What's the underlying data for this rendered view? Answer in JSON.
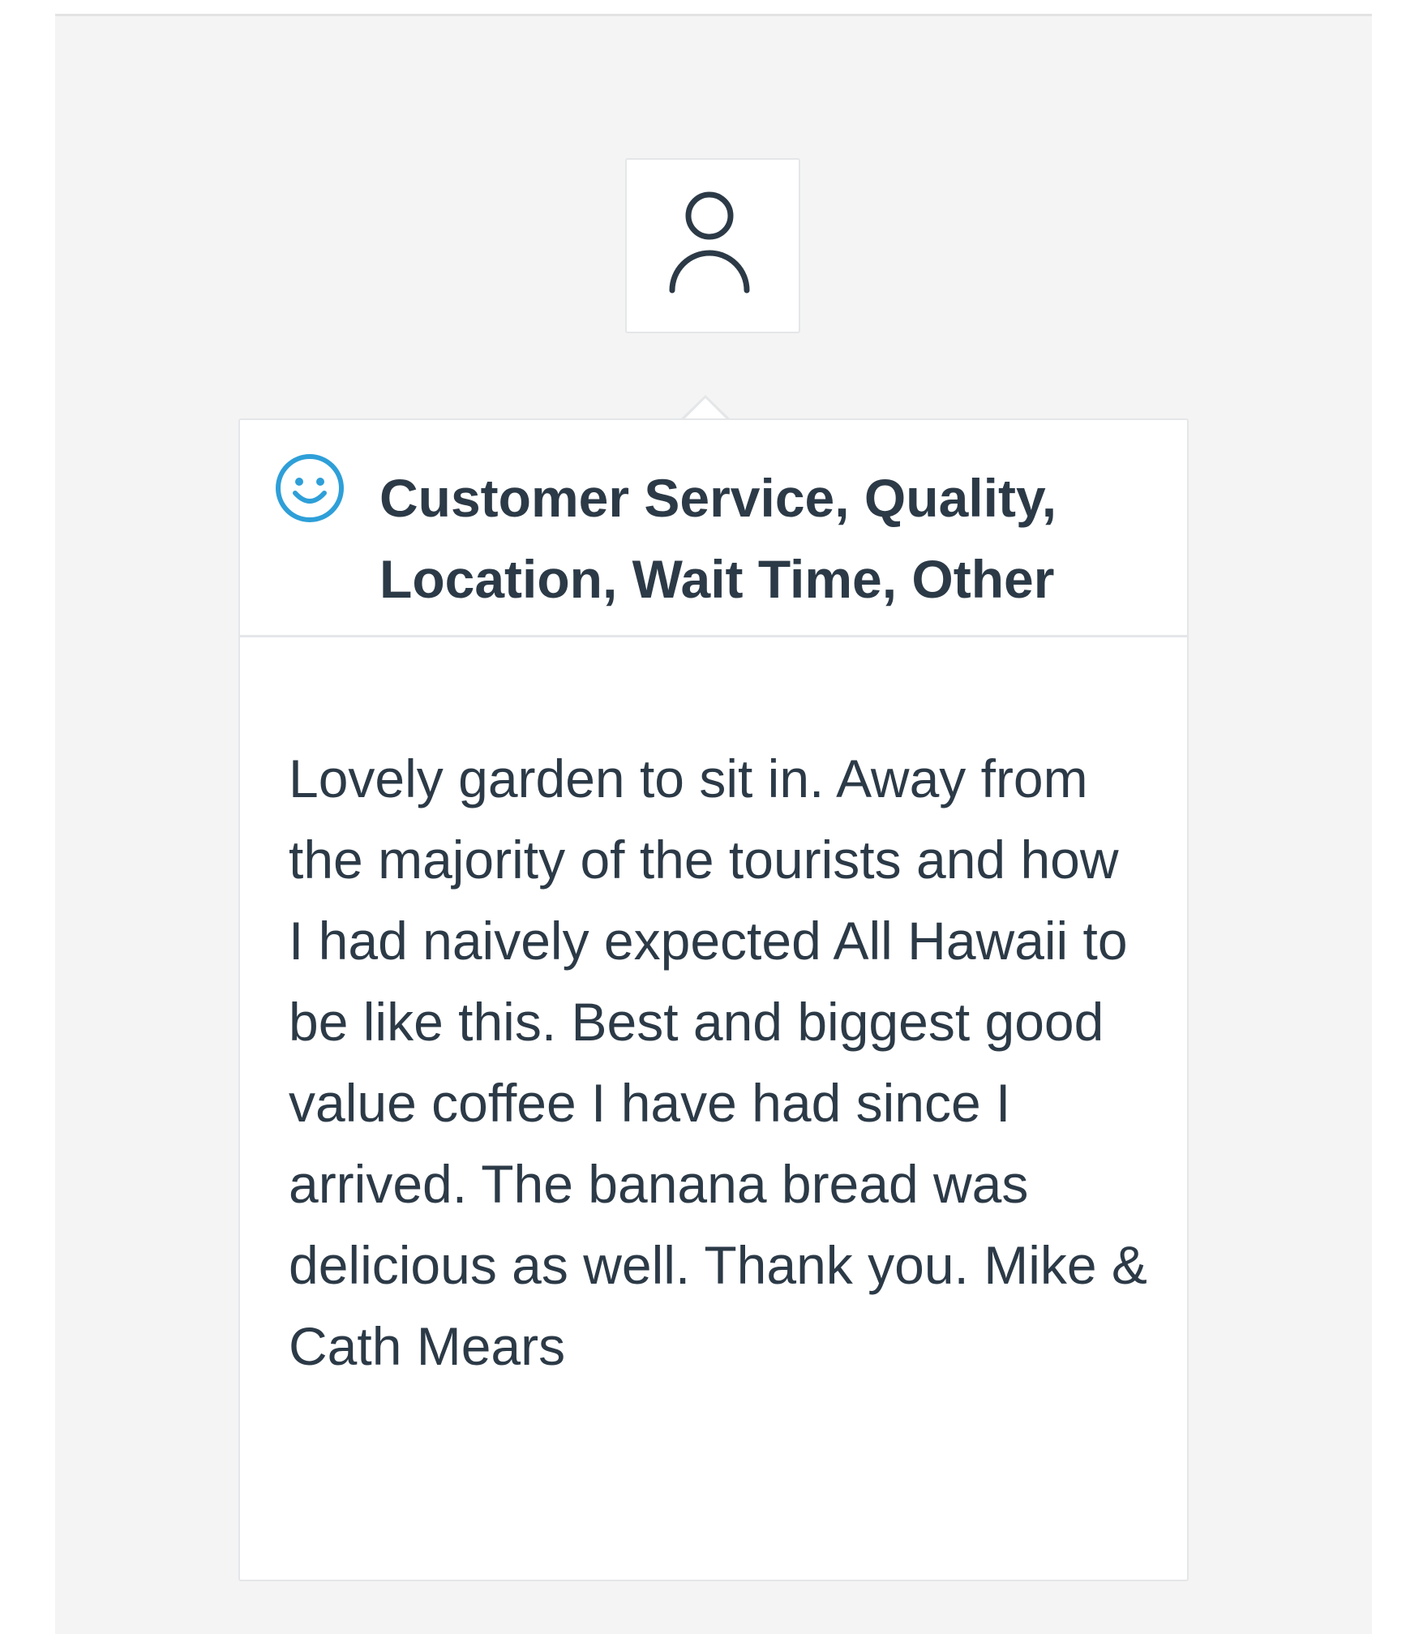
{
  "reviewer": {
    "avatar_icon": "person-outline-icon"
  },
  "feedback": {
    "sentiment_icon": "smiley-face-icon",
    "sentiment_color": "#2e9fd8",
    "categories": "Customer Service, Quality, Location, Wait Time, Other",
    "review_text": "Lovely garden to sit in. Away from the majority of the tourists and how I had naively expected All Hawaii to be like this. Best and biggest good value coffee I have had since I arrived. The banana bread was delicious as well. Thank you. Mike & Cath Mears"
  },
  "colors": {
    "text": "#2c3a47",
    "panel_background": "#f4f4f4",
    "card_background": "#ffffff",
    "border": "#e4e6e8"
  }
}
